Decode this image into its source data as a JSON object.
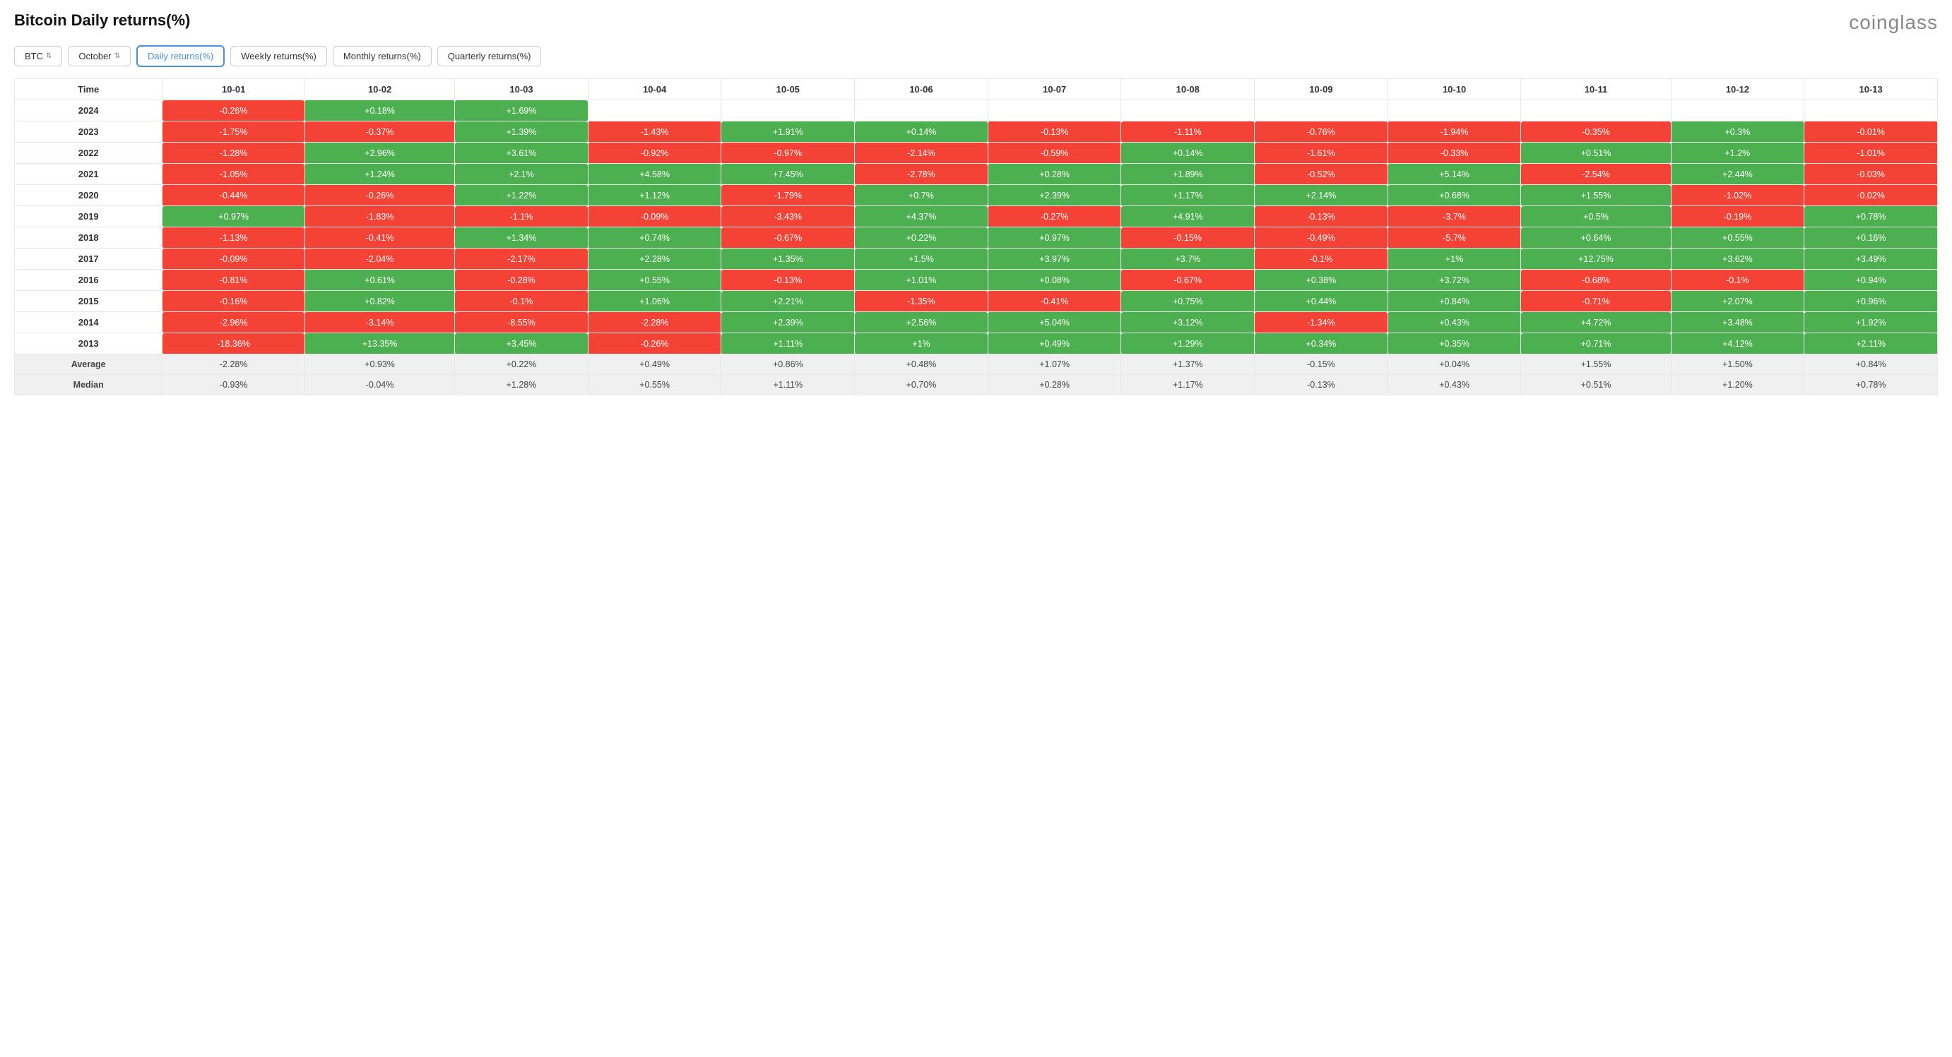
{
  "header": {
    "title": "Bitcoin Daily returns(%)",
    "brand": "coinglass"
  },
  "controls": {
    "asset": "BTC",
    "month": "October",
    "tabs": [
      {
        "label": "Daily returns(%)",
        "active": true
      },
      {
        "label": "Weekly returns(%)",
        "active": false
      },
      {
        "label": "Monthly returns(%)",
        "active": false
      },
      {
        "label": "Quarterly returns(%)",
        "active": false
      }
    ]
  },
  "table": {
    "columns": [
      "Time",
      "10-01",
      "10-02",
      "10-03",
      "10-04",
      "10-05",
      "10-06",
      "10-07",
      "10-08",
      "10-09",
      "10-10",
      "10-11",
      "10-12",
      "10-13"
    ],
    "rows": [
      {
        "year": "2024",
        "values": [
          "-0.26%",
          "+0.18%",
          "+1.69%",
          "",
          "",
          "",
          "",
          "",
          "",
          "",
          "",
          "",
          ""
        ]
      },
      {
        "year": "2023",
        "values": [
          "-1.75%",
          "-0.37%",
          "+1.39%",
          "-1.43%",
          "+1.91%",
          "+0.14%",
          "-0.13%",
          "-1.11%",
          "-0.76%",
          "-1.94%",
          "-0.35%",
          "+0.3%",
          "-0.01%"
        ]
      },
      {
        "year": "2022",
        "values": [
          "-1.28%",
          "+2.96%",
          "+3.61%",
          "-0.92%",
          "-0.97%",
          "-2.14%",
          "-0.59%",
          "+0.14%",
          "-1.61%",
          "-0.33%",
          "+0.51%",
          "+1.2%",
          "-1.01%"
        ]
      },
      {
        "year": "2021",
        "values": [
          "-1.05%",
          "+1.24%",
          "+2.1%",
          "+4.58%",
          "+7.45%",
          "-2.78%",
          "+0.28%",
          "+1.89%",
          "-0.52%",
          "+5.14%",
          "-2.54%",
          "+2.44%",
          "-0.03%"
        ]
      },
      {
        "year": "2020",
        "values": [
          "-0.44%",
          "-0.26%",
          "+1.22%",
          "+1.12%",
          "-1.79%",
          "+0.7%",
          "+2.39%",
          "+1.17%",
          "+2.14%",
          "+0.68%",
          "+1.55%",
          "-1.02%",
          "-0.02%"
        ]
      },
      {
        "year": "2019",
        "values": [
          "+0.97%",
          "-1.83%",
          "-1.1%",
          "-0.09%",
          "-3.43%",
          "+4.37%",
          "-0.27%",
          "+4.91%",
          "-0.13%",
          "-3.7%",
          "+0.5%",
          "-0.19%",
          "+0.78%"
        ]
      },
      {
        "year": "2018",
        "values": [
          "-1.13%",
          "-0.41%",
          "+1.34%",
          "+0.74%",
          "-0.67%",
          "+0.22%",
          "+0.97%",
          "-0.15%",
          "-0.49%",
          "-5.7%",
          "+0.64%",
          "+0.55%",
          "+0.16%"
        ]
      },
      {
        "year": "2017",
        "values": [
          "-0.09%",
          "-2.04%",
          "-2.17%",
          "+2.28%",
          "+1.35%",
          "+1.5%",
          "+3.97%",
          "+3.7%",
          "-0.1%",
          "+1%",
          "+12.75%",
          "+3.62%",
          "+3.49%"
        ]
      },
      {
        "year": "2016",
        "values": [
          "-0.81%",
          "+0.61%",
          "-0.28%",
          "+0.55%",
          "-0.13%",
          "+1.01%",
          "+0.08%",
          "-0.67%",
          "+0.38%",
          "+3.72%",
          "-0.68%",
          "-0.1%",
          "+0.94%"
        ]
      },
      {
        "year": "2015",
        "values": [
          "-0.16%",
          "+0.82%",
          "-0.1%",
          "+1.06%",
          "+2.21%",
          "-1.35%",
          "-0.41%",
          "+0.75%",
          "+0.44%",
          "+0.84%",
          "-0.71%",
          "+2.07%",
          "+0.96%"
        ]
      },
      {
        "year": "2014",
        "values": [
          "-2.96%",
          "-3.14%",
          "-8.55%",
          "-2.28%",
          "+2.39%",
          "+2.56%",
          "+5.04%",
          "+3.12%",
          "-1.34%",
          "+0.43%",
          "+4.72%",
          "+3.48%",
          "+1.92%"
        ]
      },
      {
        "year": "2013",
        "values": [
          "-18.36%",
          "+13.35%",
          "+3.45%",
          "-0.26%",
          "+1.11%",
          "+1%",
          "+0.49%",
          "+1.29%",
          "+0.34%",
          "+0.35%",
          "+0.71%",
          "+4.12%",
          "+2.11%"
        ]
      }
    ],
    "footer": [
      {
        "label": "Average",
        "values": [
          "-2.28%",
          "+0.93%",
          "+0.22%",
          "+0.49%",
          "+0.86%",
          "+0.48%",
          "+1.07%",
          "+1.37%",
          "-0.15%",
          "+0.04%",
          "+1.55%",
          "+1.50%",
          "+0.84%"
        ]
      },
      {
        "label": "Median",
        "values": [
          "-0.93%",
          "-0.04%",
          "+1.28%",
          "+0.55%",
          "+1.11%",
          "+0.70%",
          "+0.28%",
          "+1.17%",
          "-0.13%",
          "+0.43%",
          "+0.51%",
          "+1.20%",
          "+0.78%"
        ]
      }
    ]
  }
}
